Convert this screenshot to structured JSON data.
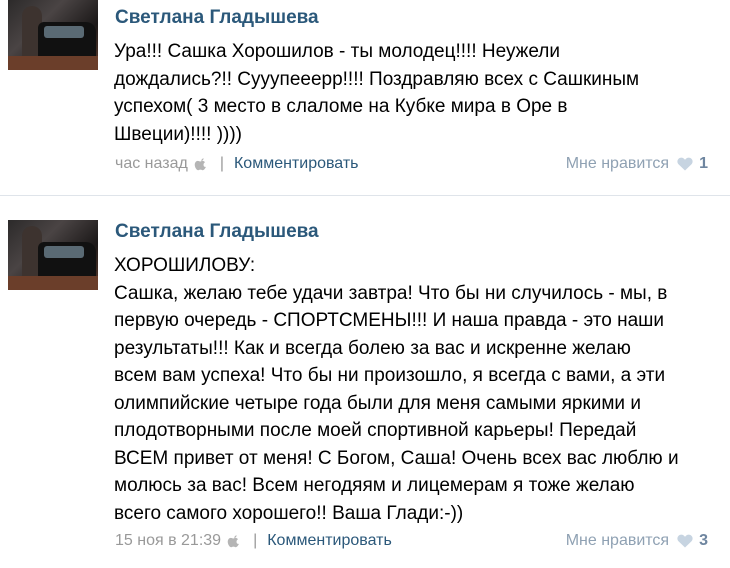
{
  "posts": [
    {
      "author": "Светлана Гладышева",
      "text": "Ура!!! Сашка Хорошилов - ты молодец!!!! Неужели\nдождались?!! Сууупееерр!!!! Поздравляю всех с Сашкиным\nуспехом( 3 место в слаломе на Кубке мира в Оре в\nШвеции)!!!! ))))",
      "time": "час назад",
      "comment_label": "Комментировать",
      "like_label": "Мне нравится",
      "like_count": "1"
    },
    {
      "author": "Светлана Гладышева",
      "text": "ХОРОШИЛОВУ:\nСашка, желаю тебе удачи завтра! Что бы ни случилось - мы, в\nпервую очередь - СПОРТСМЕНЫ!!! И наша правда - это наши\nрезультаты!!! Как и всегда болею за вас и искренне желаю\nвсем вам успеха! Что бы ни произошло, я всегда с вами, а эти\nолимпийские четыре года были для меня самыми яркими и\nплодотворными после моей спортивной карьеры! Передай\nВСЕМ привет от меня! С Богом, Саша! Очень всех вас люблю и\nмолюсь за вас! Всем негодяям и лицемерам я тоже желаю\nвсего самого хорошего!! Ваша Глади:-))",
      "time": "15 ноя в 21:39",
      "comment_label": "Комментировать",
      "like_label": "Мне нравится",
      "like_count": "3"
    }
  ],
  "icons": {
    "device": "apple-icon",
    "like": "heart-icon"
  },
  "colors": {
    "author": "#2b587a",
    "meta": "#999999",
    "like": "#8fa1b3"
  }
}
